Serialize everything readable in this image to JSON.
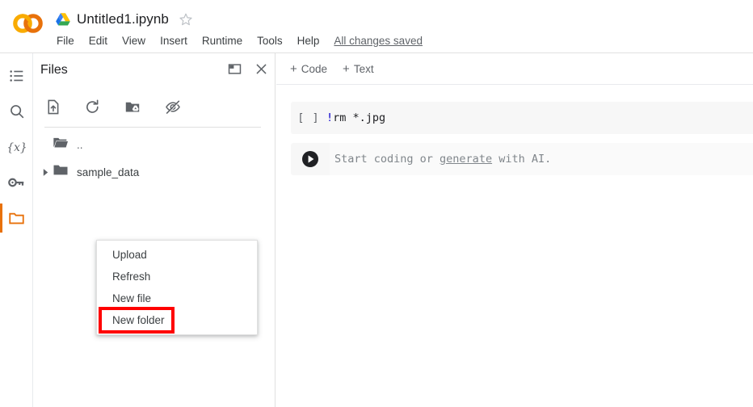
{
  "header": {
    "logo_icon": "colab-logo",
    "drive_icon": "google-drive-icon",
    "notebook_title": "Untitled1.ipynb",
    "star_icon": "star-outline-icon",
    "menus": [
      "File",
      "Edit",
      "View",
      "Insert",
      "Runtime",
      "Tools",
      "Help"
    ],
    "save_status": "All changes saved"
  },
  "rail": {
    "items": [
      {
        "icon": "table-of-contents-icon",
        "name": "toc",
        "active": false
      },
      {
        "icon": "search-icon",
        "name": "search",
        "active": false
      },
      {
        "icon": "variables-icon",
        "name": "variables",
        "active": false
      },
      {
        "icon": "key-icon",
        "name": "secrets",
        "active": false
      },
      {
        "icon": "folder-icon",
        "name": "files",
        "active": true
      }
    ],
    "accent_color": "#e8710a"
  },
  "files_panel": {
    "title": "Files",
    "header_icons": [
      {
        "icon": "panel-expand-icon",
        "name": "expand-panel"
      },
      {
        "icon": "close-icon",
        "name": "close-panel"
      }
    ],
    "toolbar_icons": [
      {
        "icon": "upload-file-icon",
        "name": "upload-to-session-storage"
      },
      {
        "icon": "refresh-icon",
        "name": "refresh-files"
      },
      {
        "icon": "mount-drive-icon",
        "name": "mount-google-drive"
      },
      {
        "icon": "eye-off-icon",
        "name": "toggle-hidden-files"
      }
    ],
    "tree": [
      {
        "label": "..",
        "icon": "folder-open-icon",
        "has_caret": false
      },
      {
        "label": "sample_data",
        "icon": "folder-icon",
        "has_caret": true
      }
    ]
  },
  "context_menu": {
    "items": [
      "Upload",
      "Refresh",
      "New file",
      "New folder"
    ],
    "highlighted_item": "New folder",
    "highlight_color": "#ff0000"
  },
  "notebook": {
    "toolbar": {
      "add_code_label": "Code",
      "add_text_label": "Text",
      "plus_glyph": "+"
    },
    "cells": [
      {
        "type": "code",
        "prompt": "[ ]",
        "source_prefix": "!",
        "source_rest": "rm *.jpg"
      },
      {
        "type": "ai-placeholder",
        "run_icon": "play-circle-icon",
        "text_before": "Start coding or ",
        "link_text": "generate",
        "text_after": " with AI."
      }
    ]
  }
}
